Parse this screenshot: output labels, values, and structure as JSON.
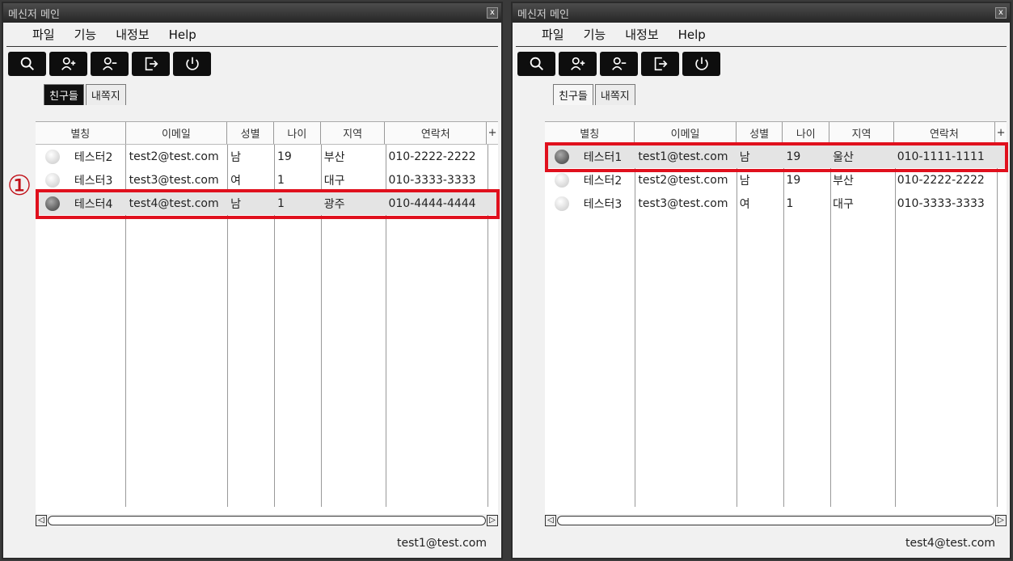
{
  "windows": [
    {
      "title": "메신저 메인",
      "close_icon": "x",
      "menu": [
        "파일",
        "기능",
        "내정보",
        "Help"
      ],
      "tools": [
        "search-icon",
        "add-user-icon",
        "remove-user-icon",
        "logout-icon",
        "power-icon"
      ],
      "tabs": [
        "친구들",
        "내쪽지"
      ],
      "columns": [
        "별칭",
        "이메일",
        "성별",
        "나이",
        "지역",
        "연락처"
      ],
      "add_column_glyph": "+",
      "rows": [
        {
          "status": "offline",
          "alias": "테스터2",
          "email": "test2@test.com",
          "gender": "남",
          "age": "19",
          "region": "부산",
          "phone": "010-2222-2222"
        },
        {
          "status": "offline",
          "alias": "테스터3",
          "email": "test3@test.com",
          "gender": "여",
          "age": "1",
          "region": "대구",
          "phone": "010-3333-3333"
        },
        {
          "status": "online",
          "alias": "테스터4",
          "email": "test4@test.com",
          "gender": "남",
          "age": "1",
          "region": "광주",
          "phone": "010-4444-4444"
        }
      ],
      "selected_row": 2,
      "scroll_left": "◁",
      "scroll_right": "▷",
      "footer_user": "test1@test.com",
      "annotation_marker": "①"
    },
    {
      "title": "메신저 메인",
      "close_icon": "x",
      "menu": [
        "파일",
        "기능",
        "내정보",
        "Help"
      ],
      "tools": [
        "search-icon",
        "add-user-icon",
        "remove-user-icon",
        "logout-icon",
        "power-icon"
      ],
      "tabs": [
        "친구들",
        "내쪽지"
      ],
      "columns": [
        "별칭",
        "이메일",
        "성별",
        "나이",
        "지역",
        "연락처"
      ],
      "add_column_glyph": "+",
      "rows": [
        {
          "status": "online",
          "alias": "테스터1",
          "email": "test1@test.com",
          "gender": "남",
          "age": "19",
          "region": "울산",
          "phone": "010-1111-1111"
        },
        {
          "status": "offline",
          "alias": "테스터2",
          "email": "test2@test.com",
          "gender": "남",
          "age": "19",
          "region": "부산",
          "phone": "010-2222-2222"
        },
        {
          "status": "offline",
          "alias": "테스터3",
          "email": "test3@test.com",
          "gender": "여",
          "age": "1",
          "region": "대구",
          "phone": "010-3333-3333"
        }
      ],
      "selected_row": 0,
      "scroll_left": "◁",
      "scroll_right": "▷",
      "footer_user": "test4@test.com"
    }
  ],
  "colors": {
    "highlight": "#e0101d",
    "toolbar": "#0e0e0e",
    "titlebar": "#2d2d2d"
  }
}
